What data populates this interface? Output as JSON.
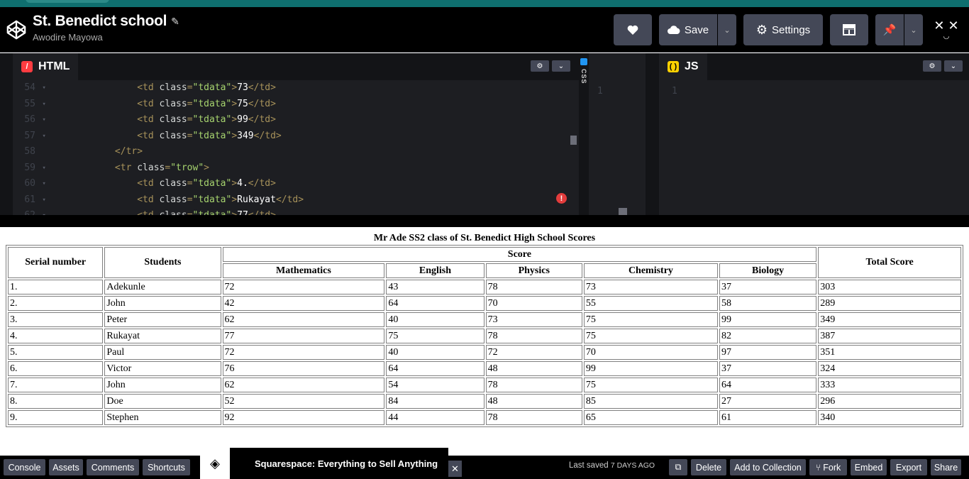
{
  "header": {
    "title": "St. Benedict school",
    "author": "Awodire Mayowa",
    "save_label": "Save",
    "settings_label": "Settings"
  },
  "editors": {
    "html_tab": "HTML",
    "css_tab": "CSS",
    "js_tab": "JS",
    "css_line": "1",
    "js_line": "1",
    "lines": [
      {
        "n": "54",
        "indent": "        ",
        "kind": "td",
        "val": "73"
      },
      {
        "n": "55",
        "indent": "        ",
        "kind": "td",
        "val": "75"
      },
      {
        "n": "56",
        "indent": "        ",
        "kind": "td",
        "val": "99"
      },
      {
        "n": "57",
        "indent": "        ",
        "kind": "td",
        "val": "349"
      },
      {
        "n": "58",
        "indent": "    ",
        "kind": "close"
      },
      {
        "n": "59",
        "indent": "    ",
        "kind": "tr"
      },
      {
        "n": "60",
        "indent": "        ",
        "kind": "td",
        "val": "4."
      },
      {
        "n": "61",
        "indent": "        ",
        "kind": "td",
        "val": "Rukayat"
      },
      {
        "n": "62",
        "indent": "        ",
        "kind": "td",
        "val": "77"
      }
    ]
  },
  "result": {
    "caption": "Mr Ade SS2 class of St. Benedict High School Scores",
    "headers": {
      "serial": "Serial number",
      "students": "Students",
      "score": "Score",
      "total": "Total Score",
      "subjects": [
        "Mathematics",
        "English",
        "Physics",
        "Chemistry",
        "Biology"
      ]
    },
    "rows": [
      [
        "1.",
        "Adekunle",
        "72",
        "43",
        "78",
        "73",
        "37",
        "303"
      ],
      [
        "2.",
        "John",
        "42",
        "64",
        "70",
        "55",
        "58",
        "289"
      ],
      [
        "3.",
        "Peter",
        "62",
        "40",
        "73",
        "75",
        "99",
        "349"
      ],
      [
        "4.",
        "Rukayat",
        "77",
        "75",
        "78",
        "75",
        "82",
        "387"
      ],
      [
        "5.",
        "Paul",
        "72",
        "40",
        "72",
        "70",
        "97",
        "351"
      ],
      [
        "6.",
        "Victor",
        "76",
        "64",
        "48",
        "99",
        "37",
        "324"
      ],
      [
        "7.",
        "John",
        "62",
        "54",
        "78",
        "75",
        "64",
        "333"
      ],
      [
        "8.",
        "Doe",
        "52",
        "84",
        "48",
        "85",
        "27",
        "296"
      ],
      [
        "9.",
        "Stephen",
        "92",
        "44",
        "78",
        "65",
        "61",
        "340"
      ]
    ]
  },
  "footer": {
    "buttons_left": [
      "Console",
      "Assets",
      "Comments",
      "Shortcuts"
    ],
    "ad_text": "Squarespace: Everything to Sell Anything",
    "last_saved_label": "Last saved",
    "last_saved_value": "7 DAYS AGO",
    "buttons_right": [
      "Delete",
      "Add to Collection",
      "Fork",
      "Embed",
      "Export",
      "Share"
    ]
  },
  "colors": {
    "header_bg": "#000000",
    "button_bg": "#444857",
    "editor_bg": "#1d1e22",
    "html_badge": "#ff3c41",
    "css_badge": "#0ebeff",
    "js_badge": "#fcd000"
  },
  "icons": [
    "codepen-logo-icon",
    "pencil-icon",
    "heart-icon",
    "cloud-icon",
    "chevron-down-icon",
    "gear-icon",
    "layout-icon",
    "pin-icon",
    "error-icon",
    "external-link-icon",
    "fork-icon",
    "close-icon",
    "squarespace-logo-icon"
  ]
}
